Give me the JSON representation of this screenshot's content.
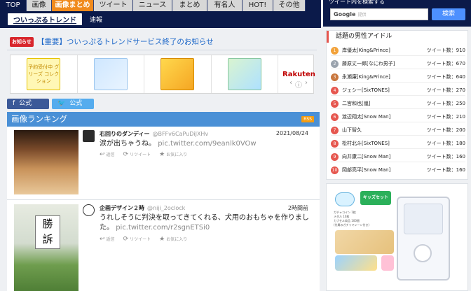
{
  "nav": {
    "items": [
      "TOP",
      "画像",
      "画像まとめ",
      "ツイート",
      "ニュース",
      "まとめ",
      "有名人",
      "HOT!",
      "その他"
    ],
    "sub_active": "ついっぷるトレンド",
    "sub_link": "速報"
  },
  "notice": {
    "badge": "お知らせ",
    "title": "【重要】ついっぷるトレンドサービス終了のお知らせ"
  },
  "banner": {
    "items": [
      {
        "label": "予約受付中 グリーズ コレクション"
      },
      {
        "label": ""
      },
      {
        "label": ""
      },
      {
        "label": ""
      },
      {
        "label": "Rakuten"
      }
    ]
  },
  "social": {
    "fb_label": "公式",
    "tw_label": "公式"
  },
  "ranking": {
    "title": "画像ランキング",
    "rss": "RSS",
    "entries": [
      {
        "user": "右回りのダンディー",
        "handle": "@BFFv6CaPuDiJXHv",
        "date": "2021/08/24",
        "text": "涙が出ちゃうね。",
        "link": "pic.twitter.com/9eanlk0VOw",
        "actions": [
          "返信",
          "リツイート",
          "お気に入り"
        ]
      },
      {
        "user": "企画デザイン２時",
        "handle": "@niji_2oclock",
        "date": "2時間前",
        "text": "うれしそうに判決を取ってきてくれる、犬用のおもちゃを作りました。",
        "link": "pic.twitter.com/r2sgnETSi0",
        "actions": [
          "返信",
          "リツイート",
          "お気に入り"
        ],
        "kanji": "勝\n訴"
      }
    ]
  },
  "search": {
    "title": "ツイート内を検索する",
    "google": "Google",
    "placeholder": "提供",
    "button": "検索"
  },
  "idols": {
    "title": "話題の男性アイドル",
    "count_label": "ツイート数：",
    "rows": [
      {
        "rank": "1",
        "name": "岸優太[King&Prince]",
        "count": "ツイート数：910",
        "color": "#f2a23a"
      },
      {
        "rank": "2",
        "name": "藤原丈一郎[なにわ男子]",
        "count": "ツイート数：670",
        "color": "#9aa3ad"
      },
      {
        "rank": "3",
        "name": "永瀬廉[King&Prince]",
        "count": "ツイート数：640",
        "color": "#c9773e"
      },
      {
        "rank": "4",
        "name": "ジェシー[SixTONES]",
        "count": "ツイート数：270",
        "color": "#e6574f"
      },
      {
        "rank": "5",
        "name": "二宮和也[嵐]",
        "count": "ツイート数：250",
        "color": "#e6574f"
      },
      {
        "rank": "6",
        "name": "渡辺翔太[Snow Man]",
        "count": "ツイート数：210",
        "color": "#e6574f"
      },
      {
        "rank": "7",
        "name": "山下智久",
        "count": "ツイート数：200",
        "color": "#e6574f"
      },
      {
        "rank": "8",
        "name": "松村北斗[SixTONES]",
        "count": "ツイート数：180",
        "color": "#e6574f"
      },
      {
        "rank": "9",
        "name": "向井康二[Snow Man]",
        "count": "ツイート数：160",
        "color": "#e6574f"
      },
      {
        "rank": "10",
        "name": "岡部亮平[Snow Man]",
        "count": "ツイート数：160",
        "color": "#e6574f"
      }
    ]
  },
  "ad": {
    "tag": "キッズセット 100 円",
    "lines": [
      "ガチャコイン 1枚",
      "メダル 10枚",
      "カプセル商品 100個",
      "(付属のガチャマシーン付き)"
    ]
  }
}
